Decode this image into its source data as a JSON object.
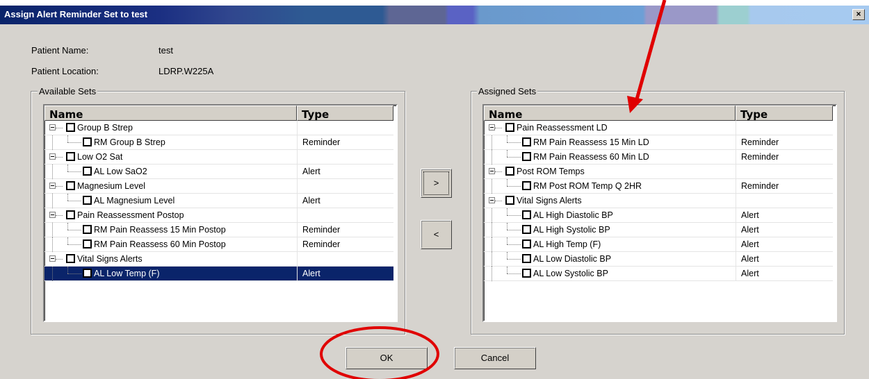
{
  "window": {
    "title": "Assign Alert Reminder Set to test",
    "close_label": "×"
  },
  "patient": {
    "name_label": "Patient Name:",
    "name_value": "test",
    "location_label": "Patient Location:",
    "location_value": "LDRP.W225A"
  },
  "available": {
    "group_title": "Available Sets",
    "col_name": "Name",
    "col_type": "Type",
    "rows": [
      {
        "label": "Group B Strep",
        "type": "",
        "level": 0
      },
      {
        "label": "RM Group B Strep",
        "type": "Reminder",
        "level": 1
      },
      {
        "label": "Low O2 Sat",
        "type": "",
        "level": 0
      },
      {
        "label": "AL Low SaO2",
        "type": "Alert",
        "level": 1
      },
      {
        "label": "Magnesium Level",
        "type": "",
        "level": 0
      },
      {
        "label": "AL Magnesium Level",
        "type": "Alert",
        "level": 1
      },
      {
        "label": "Pain Reassessment Postop",
        "type": "",
        "level": 0
      },
      {
        "label": "RM Pain Reassess 15 Min Postop",
        "type": "Reminder",
        "level": 1
      },
      {
        "label": "RM Pain Reassess 60 Min Postop",
        "type": "Reminder",
        "level": 1
      },
      {
        "label": "Vital Signs Alerts",
        "type": "",
        "level": 0
      },
      {
        "label": "AL Low Temp (F)",
        "type": "Alert",
        "level": 1,
        "selected": true
      }
    ]
  },
  "assigned": {
    "group_title": "Assigned Sets",
    "col_name": "Name",
    "col_type": "Type",
    "rows": [
      {
        "label": "Pain Reassessment LD",
        "type": "",
        "level": 0
      },
      {
        "label": "RM Pain Reassess 15 Min LD",
        "type": "Reminder",
        "level": 1
      },
      {
        "label": "RM Pain Reassess 60 Min LD",
        "type": "Reminder",
        "level": 1
      },
      {
        "label": "Post ROM Temps",
        "type": "",
        "level": 0
      },
      {
        "label": "RM Post ROM Temp Q 2HR",
        "type": "Reminder",
        "level": 1
      },
      {
        "label": "Vital Signs Alerts",
        "type": "",
        "level": 0
      },
      {
        "label": "AL High Diastolic BP",
        "type": "Alert",
        "level": 1
      },
      {
        "label": "AL High Systolic BP",
        "type": "Alert",
        "level": 1
      },
      {
        "label": "AL High Temp (F)",
        "type": "Alert",
        "level": 1
      },
      {
        "label": "AL Low Diastolic BP",
        "type": "Alert",
        "level": 1
      },
      {
        "label": "AL Low Systolic BP",
        "type": "Alert",
        "level": 1
      }
    ]
  },
  "buttons": {
    "add": ">",
    "remove": "<",
    "ok": "OK",
    "cancel": "Cancel"
  },
  "colors": {
    "selection": "#0a246a",
    "annotation": "#e00000",
    "dialog_bg": "#d6d3ce"
  }
}
